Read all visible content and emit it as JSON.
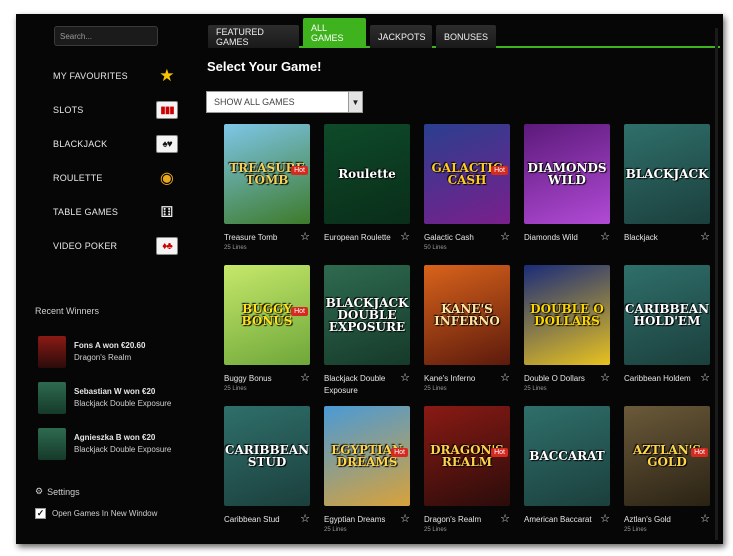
{
  "search": {
    "placeholder": "Search..."
  },
  "sidebar": {
    "categories": [
      {
        "label": "MY FAVOURITES",
        "icon": "star-icon"
      },
      {
        "label": "SLOTS",
        "icon": "slot-reels-icon"
      },
      {
        "label": "BLACKJACK",
        "icon": "playing-cards-icon"
      },
      {
        "label": "ROULETTE",
        "icon": "roulette-wheel-icon"
      },
      {
        "label": "TABLE GAMES",
        "icon": "dice-icon"
      },
      {
        "label": "VIDEO POKER",
        "icon": "poker-cards-icon"
      }
    ],
    "recent_winners_title": "Recent Winners",
    "winners": [
      {
        "line1": "Fons A won €20.60",
        "line2": "Dragon's Realm"
      },
      {
        "line1": "Sebastian W won €20",
        "line2": "Blackjack Double Exposure"
      },
      {
        "line1": "Agnieszka B won €20",
        "line2": "Blackjack Double Exposure"
      }
    ],
    "settings_title": "Settings",
    "new_window_label": "Open Games In New Window",
    "new_window_checked": true
  },
  "tabs": [
    {
      "label": "FEATURED GAMES",
      "active": false
    },
    {
      "label": "ALL GAMES",
      "active": true
    },
    {
      "label": "JACKPOTS",
      "active": false
    },
    {
      "label": "BONUSES",
      "active": false
    }
  ],
  "main": {
    "title": "Select Your Game!",
    "filter_value": "SHOW ALL GAMES"
  },
  "games": [
    {
      "name": "Treasure Tomb",
      "lines": "25 Lines",
      "art": "TREASURE TOMB",
      "hot": true,
      "colors": [
        "#7ec6e8",
        "#3d7a2a"
      ],
      "textColor": "#f3d25a"
    },
    {
      "name": "European Roulette",
      "lines": "",
      "art": "Roulette",
      "hot": false,
      "colors": [
        "#0e4a2a",
        "#0a2d19"
      ],
      "textColor": "#ffffff"
    },
    {
      "name": "Galactic Cash",
      "lines": "50 Lines",
      "art": "GALACTIC CASH",
      "hot": true,
      "colors": [
        "#2a3f8f",
        "#7a1f8c"
      ],
      "textColor": "#ffcc22"
    },
    {
      "name": "Diamonds Wild",
      "lines": "",
      "art": "DIAMONDS WILD",
      "hot": false,
      "colors": [
        "#5c1a7a",
        "#b14ad6"
      ],
      "textColor": "#ffffff"
    },
    {
      "name": "Blackjack",
      "lines": "",
      "art": "BLACKJACK",
      "hot": false,
      "colors": [
        "#2f6f6b",
        "#1b3f3c"
      ],
      "textColor": "#ffffff"
    },
    {
      "name": "Buggy Bonus",
      "lines": "25 Lines",
      "art": "BUGGY BONUS",
      "hot": true,
      "colors": [
        "#c6e86a",
        "#6ea73a"
      ],
      "textColor": "#ffe21a"
    },
    {
      "name": "Blackjack Double Exposure",
      "lines": "",
      "art": "BLACKJACK DOUBLE EXPOSURE",
      "hot": false,
      "colors": [
        "#2e6a50",
        "#163a2a"
      ],
      "textColor": "#ffffff"
    },
    {
      "name": "Kane's Inferno",
      "lines": "25 Lines",
      "art": "KANE'S INFERNO",
      "hot": false,
      "colors": [
        "#d9631b",
        "#5c1a0c"
      ],
      "textColor": "#ffe6a0"
    },
    {
      "name": "Double O Dollars",
      "lines": "25 Lines",
      "art": "DOUBLE O DOLLARS",
      "hot": false,
      "colors": [
        "#1a2b7a",
        "#e8c21f"
      ],
      "textColor": "#ffd700"
    },
    {
      "name": "Caribbean Holdem",
      "lines": "",
      "art": "CARIBBEAN HOLD'EM",
      "hot": false,
      "colors": [
        "#2f6f6b",
        "#1b3f3c"
      ],
      "textColor": "#ffffff"
    },
    {
      "name": "Caribbean Stud",
      "lines": "",
      "art": "CARIBBEAN STUD",
      "hot": false,
      "colors": [
        "#2f6f6b",
        "#1b3f3c"
      ],
      "textColor": "#ffffff"
    },
    {
      "name": "Egyptian Dreams",
      "lines": "25 Lines",
      "art": "EGYPTIAN DREAMS",
      "hot": true,
      "colors": [
        "#4a9ad6",
        "#d8a23a"
      ],
      "textColor": "#ffd54a"
    },
    {
      "name": "Dragon's Realm",
      "lines": "25 Lines",
      "art": "DRAGON'S REALM",
      "hot": true,
      "colors": [
        "#8a1a14",
        "#2a0c0a"
      ],
      "textColor": "#ffd24a"
    },
    {
      "name": "American Baccarat",
      "lines": "",
      "art": "BACCARAT",
      "hot": false,
      "colors": [
        "#2f6f6b",
        "#1b3f3c"
      ],
      "textColor": "#ffffff"
    },
    {
      "name": "Aztlan's Gold",
      "lines": "25 Lines",
      "art": "AZTLAN'S GOLD",
      "hot": true,
      "colors": [
        "#6b5a3a",
        "#2a2214"
      ],
      "textColor": "#ffd54a"
    }
  ],
  "hot_label": "Hot",
  "colors": {
    "accent": "#3fb31e",
    "background": "#060606"
  }
}
